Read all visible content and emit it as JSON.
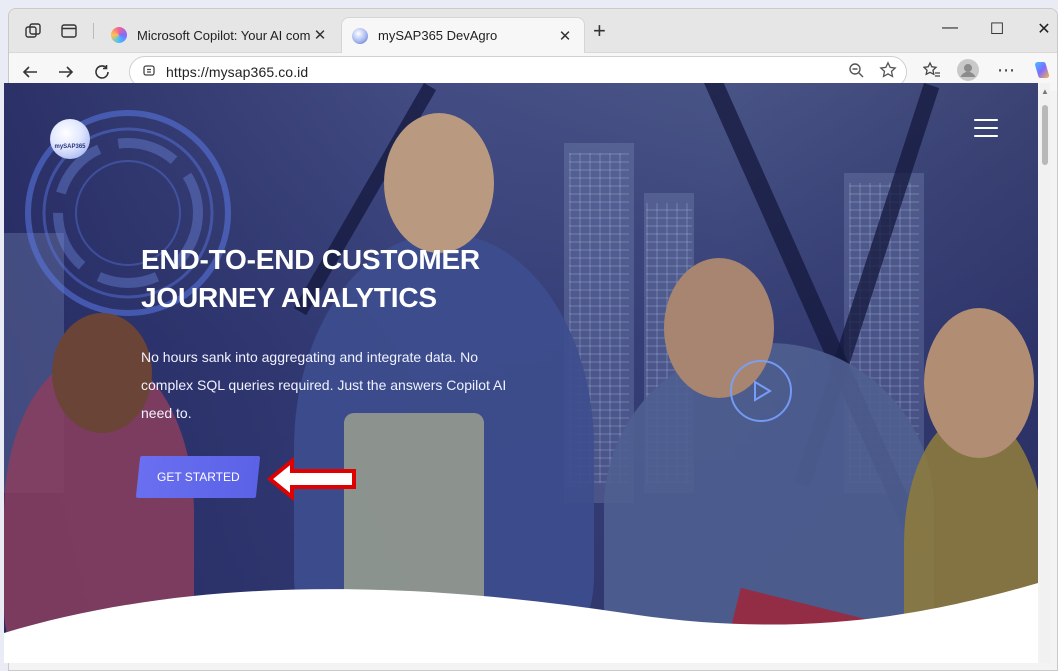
{
  "browser": {
    "tabs": [
      {
        "title": "Microsoft Copilot: Your AI compa",
        "active": false
      },
      {
        "title": "mySAP365 DevAgro",
        "active": true
      }
    ],
    "url": "https://mysap365.co.id"
  },
  "page": {
    "logo_text": "mySAP365",
    "headline_line1": "END-TO-END CUSTOMER",
    "headline_line2": "JOURNEY ANALYTICS",
    "subtext": "No hours sank into aggregating and integrate data. No complex SQL queries required. Just the answers Copilot AI need to.",
    "cta_label": "GET STARTED"
  },
  "colors": {
    "cta": "#5b62e6",
    "annotation_arrow": "#e00000",
    "overlay": "#3a3f74"
  }
}
